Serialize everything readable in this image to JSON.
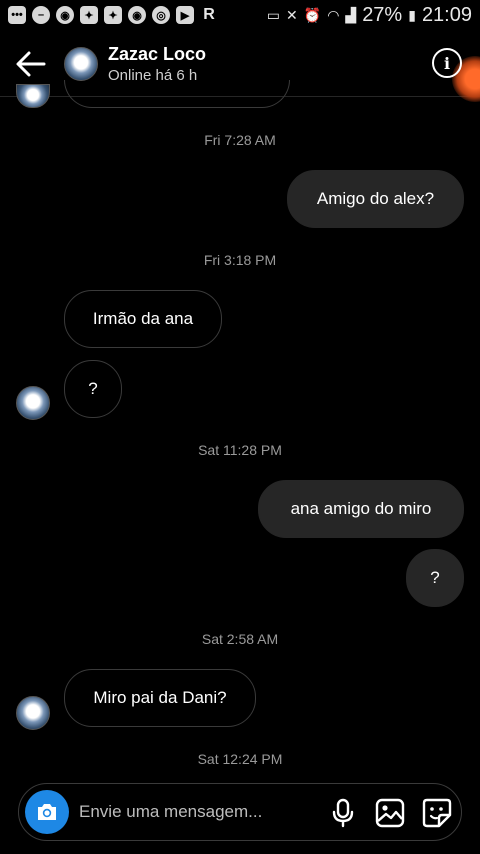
{
  "status_bar": {
    "battery": "27%",
    "time": "21:09"
  },
  "header": {
    "name": "Zazac Loco",
    "status": "Online há 6 h"
  },
  "messages": [
    {
      "type": "timestamp",
      "text": "Fri 7:28 AM"
    },
    {
      "type": "out",
      "text": "Amigo do alex?"
    },
    {
      "type": "timestamp",
      "text": "Fri 3:18 PM"
    },
    {
      "type": "in",
      "text": "Irmão da ana"
    },
    {
      "type": "in",
      "text": "?"
    },
    {
      "type": "timestamp",
      "text": "Sat 11:28 PM"
    },
    {
      "type": "out",
      "text": "ana amigo do miro"
    },
    {
      "type": "out",
      "text": "?"
    },
    {
      "type": "timestamp",
      "text": "Sat 2:58 AM"
    },
    {
      "type": "in",
      "text": "Miro pai da Dani?"
    },
    {
      "type": "timestamp",
      "text": "Sat 12:24 PM"
    }
  ],
  "composer": {
    "placeholder": "Envie uma mensagem..."
  },
  "icons": {
    "back": "arrow-left-icon",
    "info": "info-icon",
    "camera": "camera-icon",
    "mic": "microphone-icon",
    "gallery": "image-icon",
    "sticker": "sticker-icon"
  },
  "colors": {
    "background": "#000000",
    "outgoing_bubble": "#262626",
    "camera_button": "#1e88e5"
  }
}
